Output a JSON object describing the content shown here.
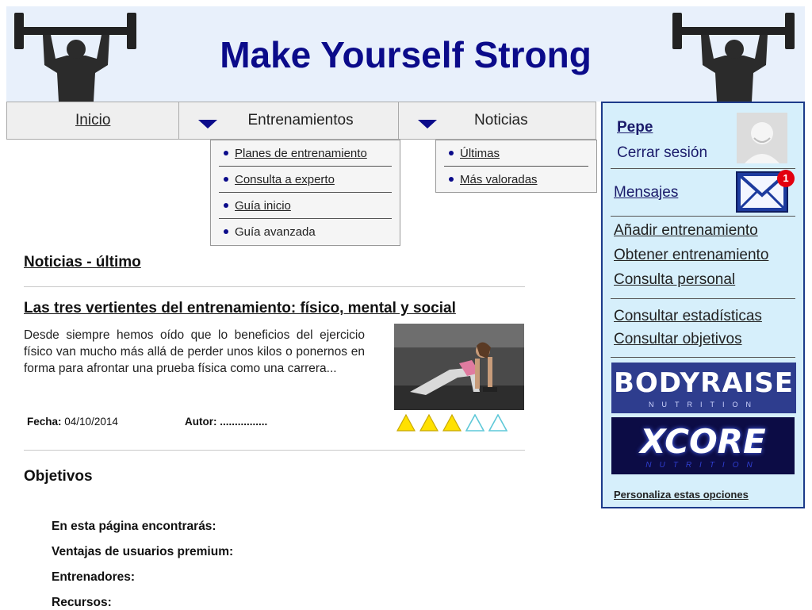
{
  "header": {
    "title": "Make Yourself Strong"
  },
  "nav": {
    "inicio": "Inicio",
    "entrenamientos": {
      "label": "Entrenamientos",
      "items": [
        "Planes de entrenamiento",
        "Consulta a experto",
        "Guía inicio",
        "Guía avanzada"
      ]
    },
    "noticias": {
      "label": "Noticias",
      "items": [
        "Últimas",
        "Más valoradas"
      ]
    }
  },
  "main": {
    "news_heading": "Noticias - último",
    "article": {
      "title": "Las tres vertientes del entrenamiento: físico, mental y social",
      "excerpt": "Desde siempre hemos oído que lo beneficios del ejercicio físico van mucho más allá de perder unos kilos o ponernos en forma para afrontar una prueba física como una carrera...",
      "date_label": "Fecha:",
      "date": "04/10/2014",
      "author_label": "Autor:",
      "author": "................",
      "rating": 3,
      "rating_max": 5
    },
    "objectives": {
      "title": "Objetivos",
      "items": [
        "En esta página encontrarás:",
        "Ventajas de usuarios premium:",
        "Entrenadores:",
        "Recursos:"
      ]
    }
  },
  "sidebar": {
    "username": "Pepe",
    "logout": "Cerrar sesión",
    "messages": "Mensajes",
    "messages_count": "1",
    "links_a": [
      "Añadir entrenamiento",
      "Obtener entrenamiento",
      "Consulta personal"
    ],
    "links_b": [
      "Consultar estadísticas",
      "Consultar objetivos"
    ],
    "brands": {
      "bodyraise": {
        "name": "BODYRAISE",
        "sub": "NUTRITION"
      },
      "xcore": {
        "name": "XCORE",
        "sub": "NUTRITION"
      }
    },
    "customize": "Personaliza estas opciones"
  },
  "colors": {
    "title": "#0b0b8a",
    "header_bg": "#e8f0fb",
    "sidebar_bg": "#d6effb",
    "sidebar_border": "#1d3b8a",
    "star_filled": "#ffe100",
    "star_empty": "#5fc8d8",
    "badge": "#e3000f"
  },
  "icons": {
    "logo": "weightlifter-icon",
    "dropdown": "caret-down-icon",
    "mail": "envelope-icon",
    "avatar": "user-avatar-icon",
    "rating": "triangle-star-icon"
  }
}
